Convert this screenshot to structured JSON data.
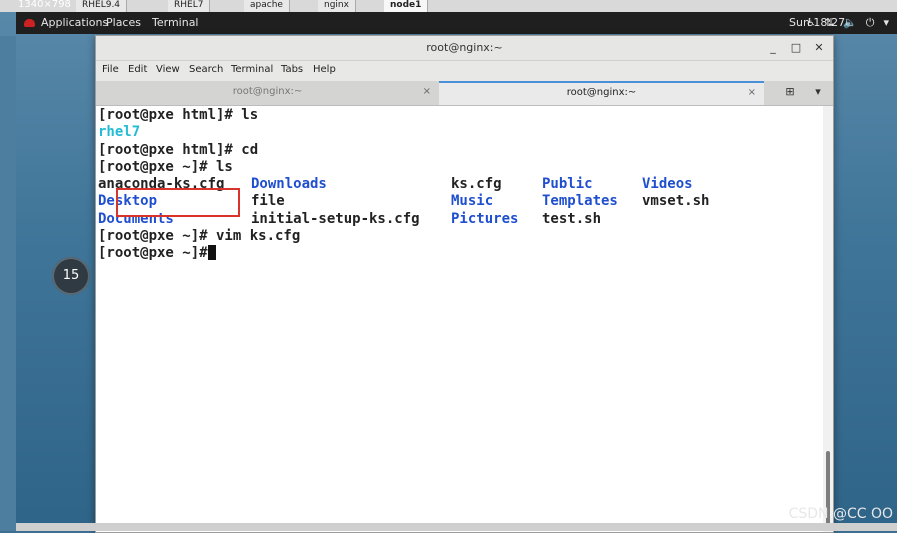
{
  "vm_tabs": [
    "RHEL9.4",
    "RHEL7",
    "apache",
    "nginx",
    "node1"
  ],
  "resolution_text": "1340×798",
  "gnome_topbar": {
    "applications": "Applications",
    "places": "Places",
    "terminal": "Terminal",
    "clock": "Sun 18:27"
  },
  "replay_badge": "15",
  "window": {
    "title": "root@nginx:~",
    "minimize": "_",
    "maximize": "□",
    "close": "✕"
  },
  "menu": [
    "File",
    "Edit",
    "View",
    "Search",
    "Terminal",
    "Tabs",
    "Help"
  ],
  "tabs": [
    {
      "label": "root@nginx:~",
      "active": false
    },
    {
      "label": "root@nginx:~",
      "active": true
    }
  ],
  "terminal": {
    "lines": [
      "[root@pxe html]# ls",
      "[root@pxe html]# cd",
      "[root@pxe ~]# ls",
      "[root@pxe ~]# vim ks.cfg",
      "[root@pxe ~]#"
    ],
    "ls_html_output": "rhel7",
    "home_listing": [
      [
        "anaconda-ks.cfg",
        "Downloads",
        "ks.cfg",
        "Public",
        "Videos"
      ],
      [
        "Desktop",
        "file",
        "Music",
        "Templates",
        "vmset.sh"
      ],
      [
        "Documents",
        "initial-setup-ks.cfg",
        "Pictures",
        "test.sh",
        ""
      ]
    ],
    "colors": {
      "dir": "#1f4fcf",
      "highlight": "#22bcd4",
      "annotation_box": "#d9342b"
    }
  },
  "watermark": "CSDN @CC OO"
}
